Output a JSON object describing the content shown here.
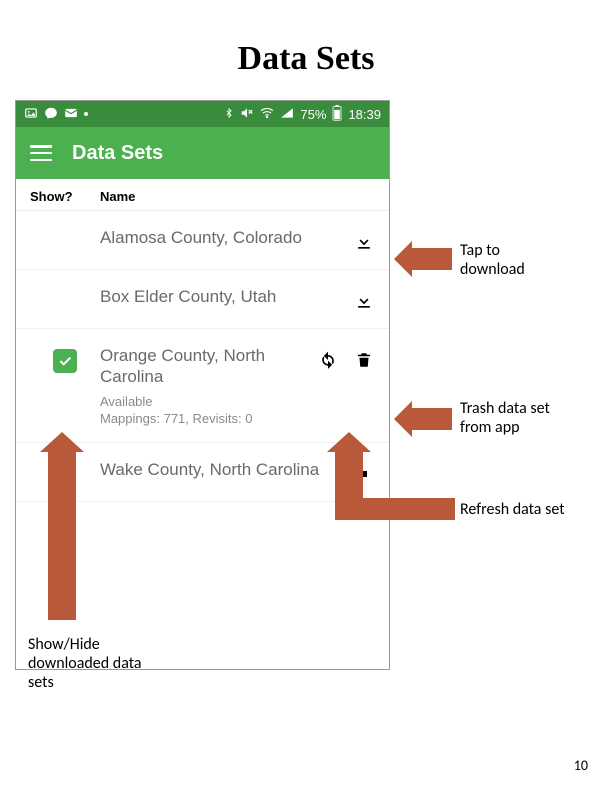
{
  "slide": {
    "title": "Data Sets",
    "page_number": "10"
  },
  "status_bar": {
    "battery": "75%",
    "time": "18:39"
  },
  "app": {
    "title": "Data Sets"
  },
  "table": {
    "header_show": "Show?",
    "header_name": "Name"
  },
  "rows": {
    "r0": {
      "name": "Alamosa County, Colorado"
    },
    "r1": {
      "name": "Box Elder County, Utah"
    },
    "r2": {
      "name": "Orange County, North Carolina",
      "status": "Available",
      "detail": "Mappings: 771, Revisits: 0"
    },
    "r3": {
      "name": "Wake County, North Carolina"
    }
  },
  "callouts": {
    "download": "Tap to download",
    "trash": "Trash data set from app",
    "refresh": "Refresh data set",
    "showhide": "Show/Hide downloaded data sets"
  }
}
